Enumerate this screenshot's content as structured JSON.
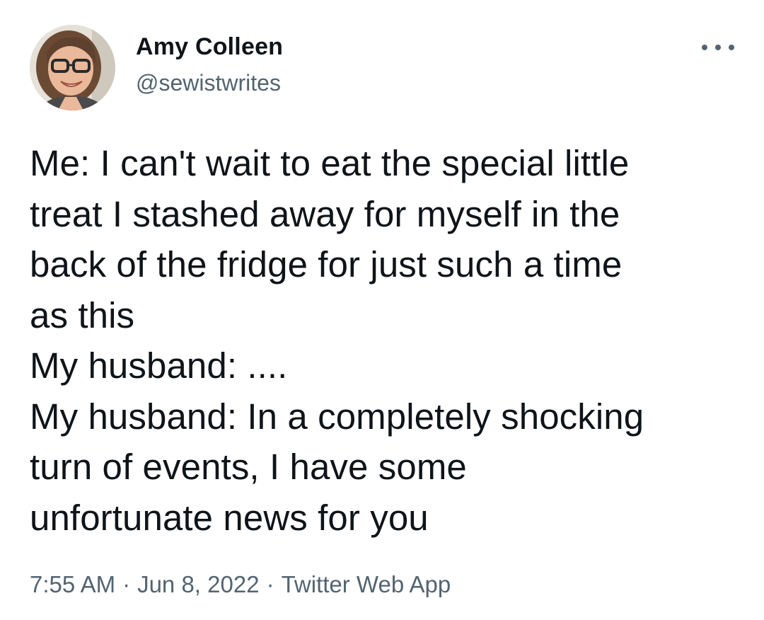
{
  "author": {
    "display_name": "Amy Colleen",
    "handle": "@sewistwrites"
  },
  "tweet": {
    "text": "Me: I can't wait to eat the special little\ntreat I stashed away for myself in the\nback of the fridge for just such a time\nas this\nMy husband: ....\nMy husband: In a completely shocking\nturn of events, I have some\nunfortunate news for you"
  },
  "meta": {
    "time": "7:55 AM",
    "separator": "·",
    "date": "Jun 8, 2022",
    "source": "Twitter Web App"
  },
  "icons": {
    "more": "more-horizontal-icon",
    "avatar": "profile-photo"
  },
  "colors": {
    "text_primary": "#0f1419",
    "text_secondary": "#536471",
    "background": "#ffffff"
  }
}
